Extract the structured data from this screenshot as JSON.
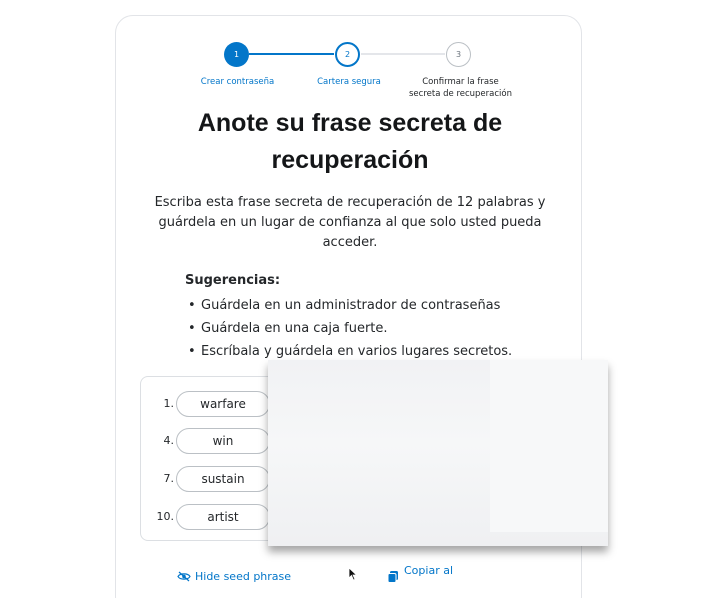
{
  "stepper": {
    "steps": [
      {
        "number": "1",
        "label": "Crear contraseña"
      },
      {
        "number": "2",
        "label": "Cartera segura"
      },
      {
        "number": "3",
        "label_line1": "Confirmar la frase",
        "label_line2": "secreta de recuperación"
      }
    ],
    "active_step": 2,
    "accent_color": "#0376c9"
  },
  "title_line1": "Anote su frase secreta de",
  "title_line2": "recuperación",
  "description_line1": "Escriba esta frase secreta de recuperación de 12 palabras y",
  "description_line2": "guárdela en un lugar de confianza al que solo usted pueda",
  "description_line3": "acceder.",
  "tips": {
    "title": "Sugerencias:",
    "items": [
      "Guárdela en un administrador de contraseñas",
      "Guárdela en una caja fuerte.",
      "Escríbala y guárdela en varios lugares secretos."
    ]
  },
  "seed": {
    "words": [
      {
        "number": "1.",
        "word": "warfare"
      },
      {
        "number": "4.",
        "word": "win"
      },
      {
        "number": "7.",
        "word": "sustain"
      },
      {
        "number": "10.",
        "word": "artist"
      }
    ]
  },
  "footer": {
    "hide_label": "Hide seed phrase",
    "copy_label": "Copiar al"
  }
}
